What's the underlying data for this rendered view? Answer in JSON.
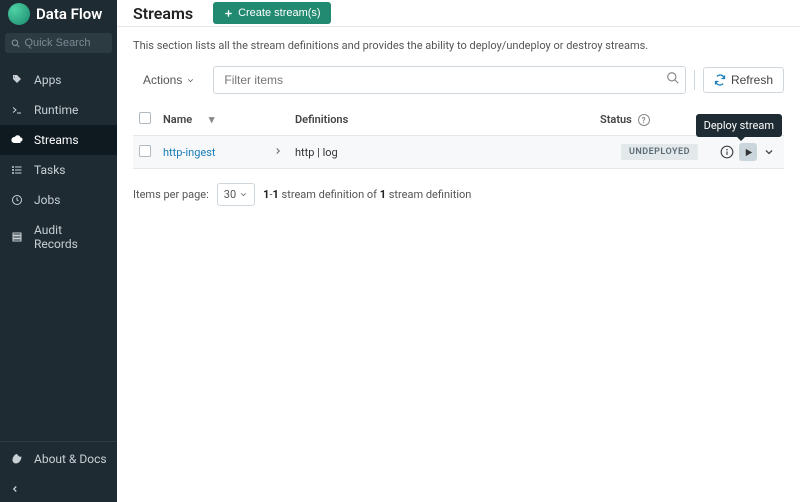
{
  "brand": {
    "title": "Data Flow"
  },
  "search": {
    "placeholder": "Quick Search"
  },
  "nav": {
    "items": [
      {
        "label": "Apps"
      },
      {
        "label": "Runtime"
      },
      {
        "label": "Streams"
      },
      {
        "label": "Tasks"
      },
      {
        "label": "Jobs"
      },
      {
        "label": "Audit Records"
      }
    ],
    "footer": {
      "label": "About & Docs"
    }
  },
  "page": {
    "title": "Streams",
    "create_label": "Create stream(s)",
    "description": "This section lists all the stream definitions and provides the ability to deploy/undeploy or destroy streams."
  },
  "toolbar": {
    "actions_label": "Actions",
    "filter_placeholder": "Filter items",
    "refresh_label": "Refresh"
  },
  "table": {
    "headers": {
      "name": "Name",
      "definitions": "Definitions",
      "status": "Status"
    },
    "rows": [
      {
        "name": "http-ingest",
        "definition": "http | log",
        "status": "UNDEPLOYED"
      }
    ]
  },
  "pager": {
    "label": "Items per page:",
    "size": "30",
    "range_from": "1",
    "range_to": "1",
    "mid1": " stream definition of ",
    "total": "1",
    "suffix": " stream definition"
  },
  "tooltip": {
    "deploy": "Deploy stream"
  }
}
